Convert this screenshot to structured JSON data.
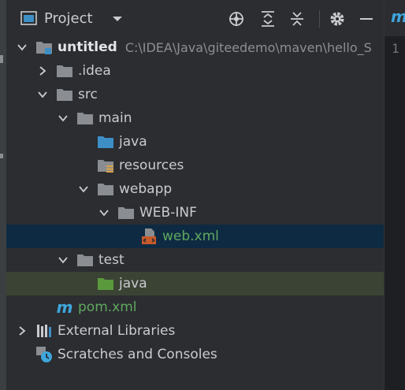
{
  "panel": {
    "title": "Project",
    "tools": [
      "locate-icon",
      "expand-all-icon",
      "collapse-all-icon",
      "gear-icon",
      "minimize-icon"
    ]
  },
  "tree": {
    "root": {
      "label": "untitled",
      "path": "C:\\IDEA\\Java\\giteedemo\\maven\\hello_S"
    },
    "idea": "idea",
    "src": "src",
    "main": "main",
    "java_main": "java",
    "resources": "resources",
    "webapp": "webapp",
    "webinf": "WEB-INF",
    "webxml": "web.xml",
    "test": "test",
    "java_test": "java",
    "pom": "pom.xml",
    "extlibs": "External Libraries",
    "scratches": "Scratches and Consoles"
  },
  "editor": {
    "tab_icon": "m",
    "line_number": "1"
  },
  "colors": {
    "panel_bg": "#2b2d30",
    "selection": "#0e2a42",
    "hover": "#3b4334",
    "folder": "#8a8d91",
    "source_folder": "#3d8fc6",
    "test_folder": "#5a9a3c",
    "green_text": "#5fa85f",
    "maven_blue": "#3ea6dd"
  }
}
